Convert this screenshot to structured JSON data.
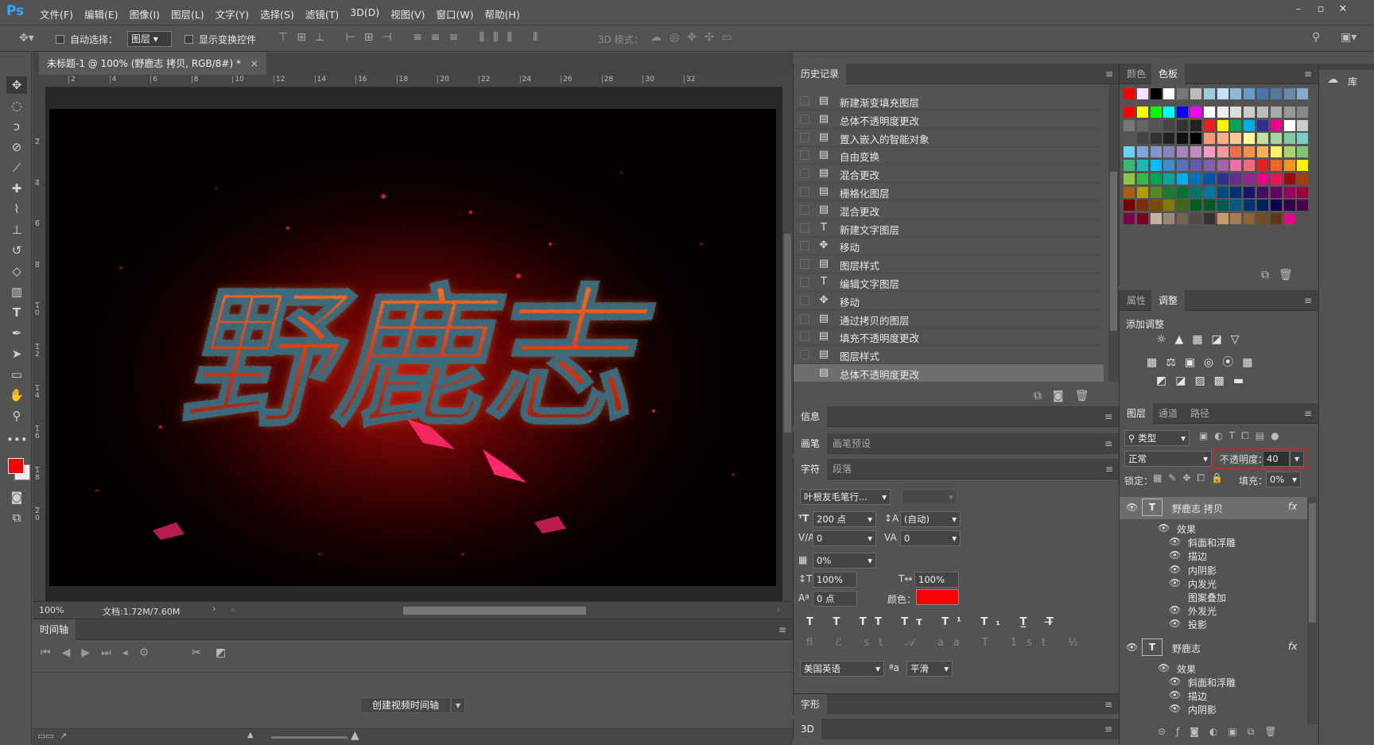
{
  "app": {
    "logo": "Ps"
  },
  "menu": [
    "文件(F)",
    "编辑(E)",
    "图像(I)",
    "图层(L)",
    "文字(Y)",
    "选择(S)",
    "滤镜(T)",
    "3D(D)",
    "视图(V)",
    "窗口(W)",
    "帮助(H)"
  ],
  "options": {
    "auto_select": "自动选择：",
    "auto_select_value": "图层",
    "show_transform": "显示变换控件",
    "mode3d": "3D 模式："
  },
  "doc": {
    "tab": "未标题-1 @ 100% (野鹿志 拷贝, RGB/8#) *",
    "close": "×",
    "zoom": "100%",
    "docinfo": "文档:1.72M/7.60M",
    "artwork_text": "野鹿志"
  },
  "ruler_h": [
    "2",
    "4",
    "6",
    "8",
    "10",
    "12",
    "14",
    "16",
    "18",
    "20",
    "22",
    "24",
    "26",
    "28",
    "30",
    "32"
  ],
  "ruler_v": [
    "2",
    "4",
    "6",
    "8",
    "1\n0",
    "1\n2",
    "1\n4",
    "1\n6",
    "1\n8",
    "2\n0"
  ],
  "timeline": {
    "tab": "时间轴",
    "create_button": "创建视频时间轴"
  },
  "history": {
    "tab": "历史记录",
    "items": [
      {
        "icon": "doc",
        "label": "新建渐变填充图层"
      },
      {
        "icon": "doc",
        "label": "总体不透明度更改"
      },
      {
        "icon": "doc",
        "label": "置入嵌入的智能对象"
      },
      {
        "icon": "doc",
        "label": "自由变换"
      },
      {
        "icon": "doc",
        "label": "混合更改"
      },
      {
        "icon": "doc",
        "label": "栅格化图层"
      },
      {
        "icon": "doc",
        "label": "混合更改"
      },
      {
        "icon": "T",
        "label": "新建文字图层"
      },
      {
        "icon": "move",
        "label": "移动"
      },
      {
        "icon": "doc",
        "label": "图层样式"
      },
      {
        "icon": "T",
        "label": "编辑文字图层"
      },
      {
        "icon": "move",
        "label": "移动"
      },
      {
        "icon": "doc",
        "label": "通过拷贝的图层"
      },
      {
        "icon": "doc",
        "label": "填充不透明度更改"
      },
      {
        "icon": "doc",
        "label": "图层样式"
      },
      {
        "icon": "doc",
        "label": "总体不透明度更改"
      }
    ]
  },
  "info": {
    "tab": "信息"
  },
  "brush": {
    "tab1": "画笔",
    "tab2": "画笔预设"
  },
  "character": {
    "tab1": "字符",
    "tab2": "段落",
    "font": "叶根友毛笔行...",
    "size": "200 点",
    "leading": "(自动)",
    "kerning": "0",
    "tracking": "0",
    "scale_pct": "0%",
    "vscale": "100%",
    "hscale": "100%",
    "baseline": "0 点",
    "color_label": "颜色：",
    "color": "#ff0000",
    "language": "美国英语",
    "aa": "平滑"
  },
  "glyphs": {
    "tab": "字形"
  },
  "p3d": {
    "tab": "3D"
  },
  "swatches": {
    "tab1": "颜色",
    "tab2": "色板"
  },
  "adjust": {
    "tab1": "属性",
    "tab2": "调整",
    "title": "添加调整"
  },
  "layers": {
    "tab1": "图层",
    "tab2": "通道",
    "tab3": "路径",
    "filter": "类型",
    "blend": "正常",
    "opacity_label": "不透明度：",
    "opacity": "40",
    "lock_label": "锁定：",
    "fill_label": "填充：",
    "fill": "0%",
    "rows": [
      {
        "type": "layer",
        "name": "野鹿志 拷贝"
      },
      {
        "type": "fx",
        "name": "效果"
      },
      {
        "type": "effect",
        "name": "斜面和浮雕"
      },
      {
        "type": "effect",
        "name": "描边"
      },
      {
        "type": "effect",
        "name": "内阴影"
      },
      {
        "type": "effect",
        "name": "内发光"
      },
      {
        "type": "effect_off",
        "name": "图案叠加"
      },
      {
        "type": "effect",
        "name": "外发光"
      },
      {
        "type": "effect",
        "name": "投影"
      },
      {
        "type": "layer",
        "name": "野鹿志"
      },
      {
        "type": "fx",
        "name": "效果"
      },
      {
        "type": "effect",
        "name": "斜面和浮雕"
      },
      {
        "type": "effect",
        "name": "描边"
      },
      {
        "type": "effect",
        "name": "内阴影"
      }
    ]
  },
  "library": {
    "label": "库"
  }
}
